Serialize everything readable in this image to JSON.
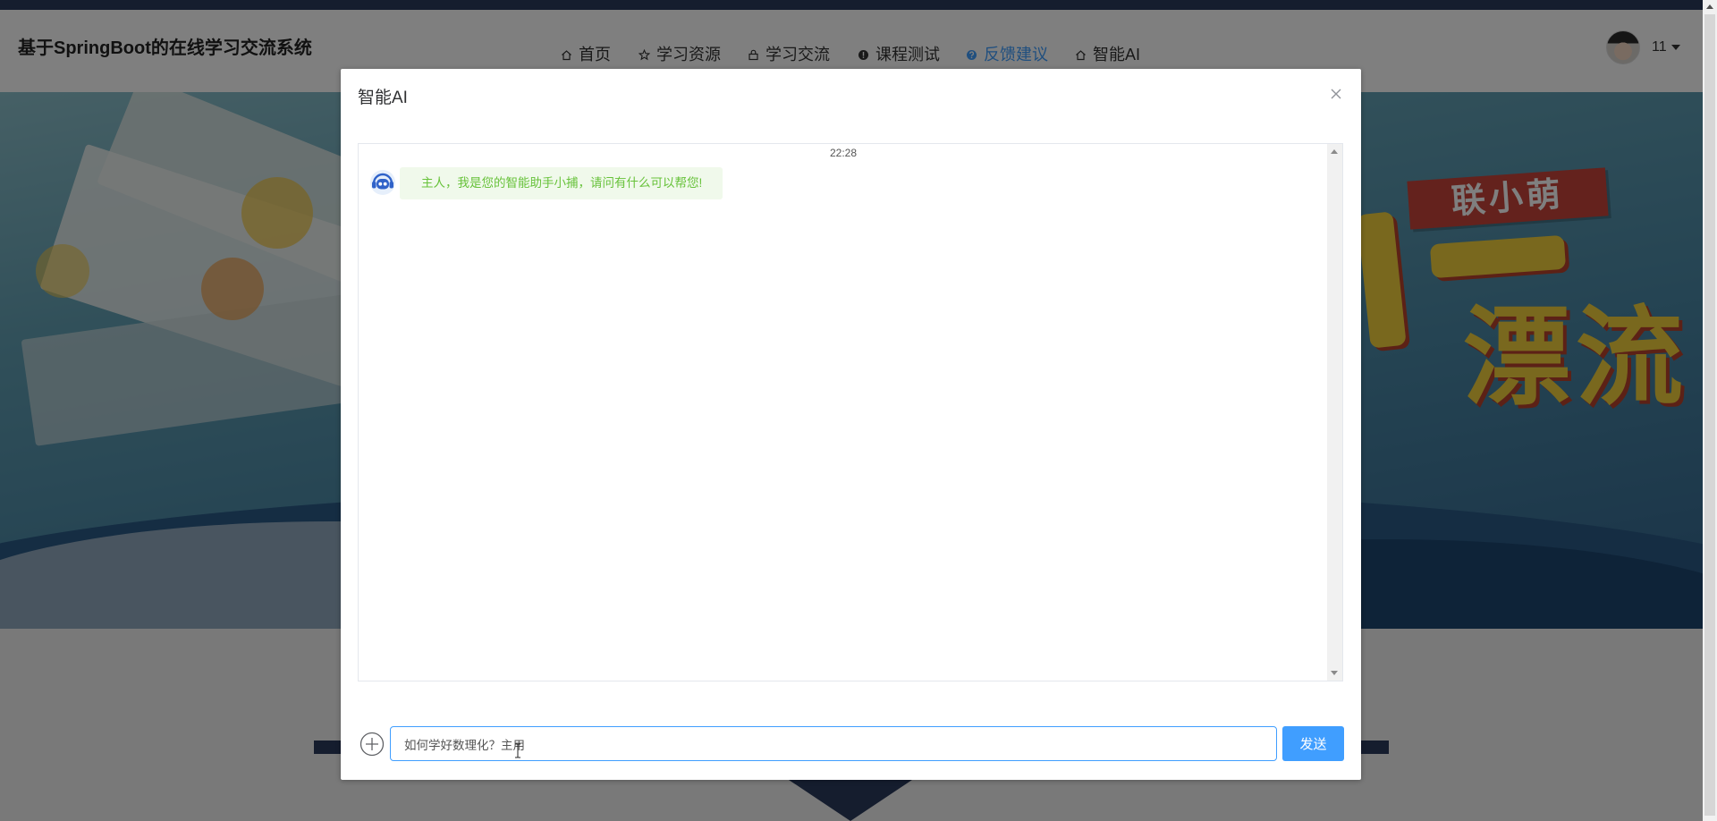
{
  "app": {
    "title": "基于SpringBoot的在线学习交流系统"
  },
  "nav": {
    "items": [
      {
        "label": "首页",
        "icon": "home-icon"
      },
      {
        "label": "学习资源",
        "icon": "star-icon"
      },
      {
        "label": "学习交流",
        "icon": "bag-icon"
      },
      {
        "label": "课程测试",
        "icon": "info-circle-icon"
      },
      {
        "label": "反馈建议",
        "icon": "question-circle-icon",
        "active": true
      },
      {
        "label": "智能AI",
        "icon": "home-icon"
      }
    ]
  },
  "user": {
    "name": "11",
    "menu_icon": "caret-down-icon"
  },
  "banner": {
    "lettering": [
      "联小萌",
      "漂流"
    ]
  },
  "dialog": {
    "title": "智能AI",
    "close_icon": "close-icon",
    "chat": {
      "timestamp": "22:28",
      "messages": [
        {
          "sender": "bot",
          "avatar": "robot-avatar-icon",
          "text": "主人，我是您的智能助手小捕，请问有什么可以帮您!"
        }
      ]
    },
    "input": {
      "value": "如何学好数理化？主用",
      "attach_icon": "plus-circle-icon"
    },
    "send_label": "发送"
  },
  "colors": {
    "accent": "#409eff",
    "bubble_bg": "#f0f9eb",
    "bubble_text": "#67c23a",
    "navy": "#2b3a5c",
    "nav_text": "#333333"
  }
}
